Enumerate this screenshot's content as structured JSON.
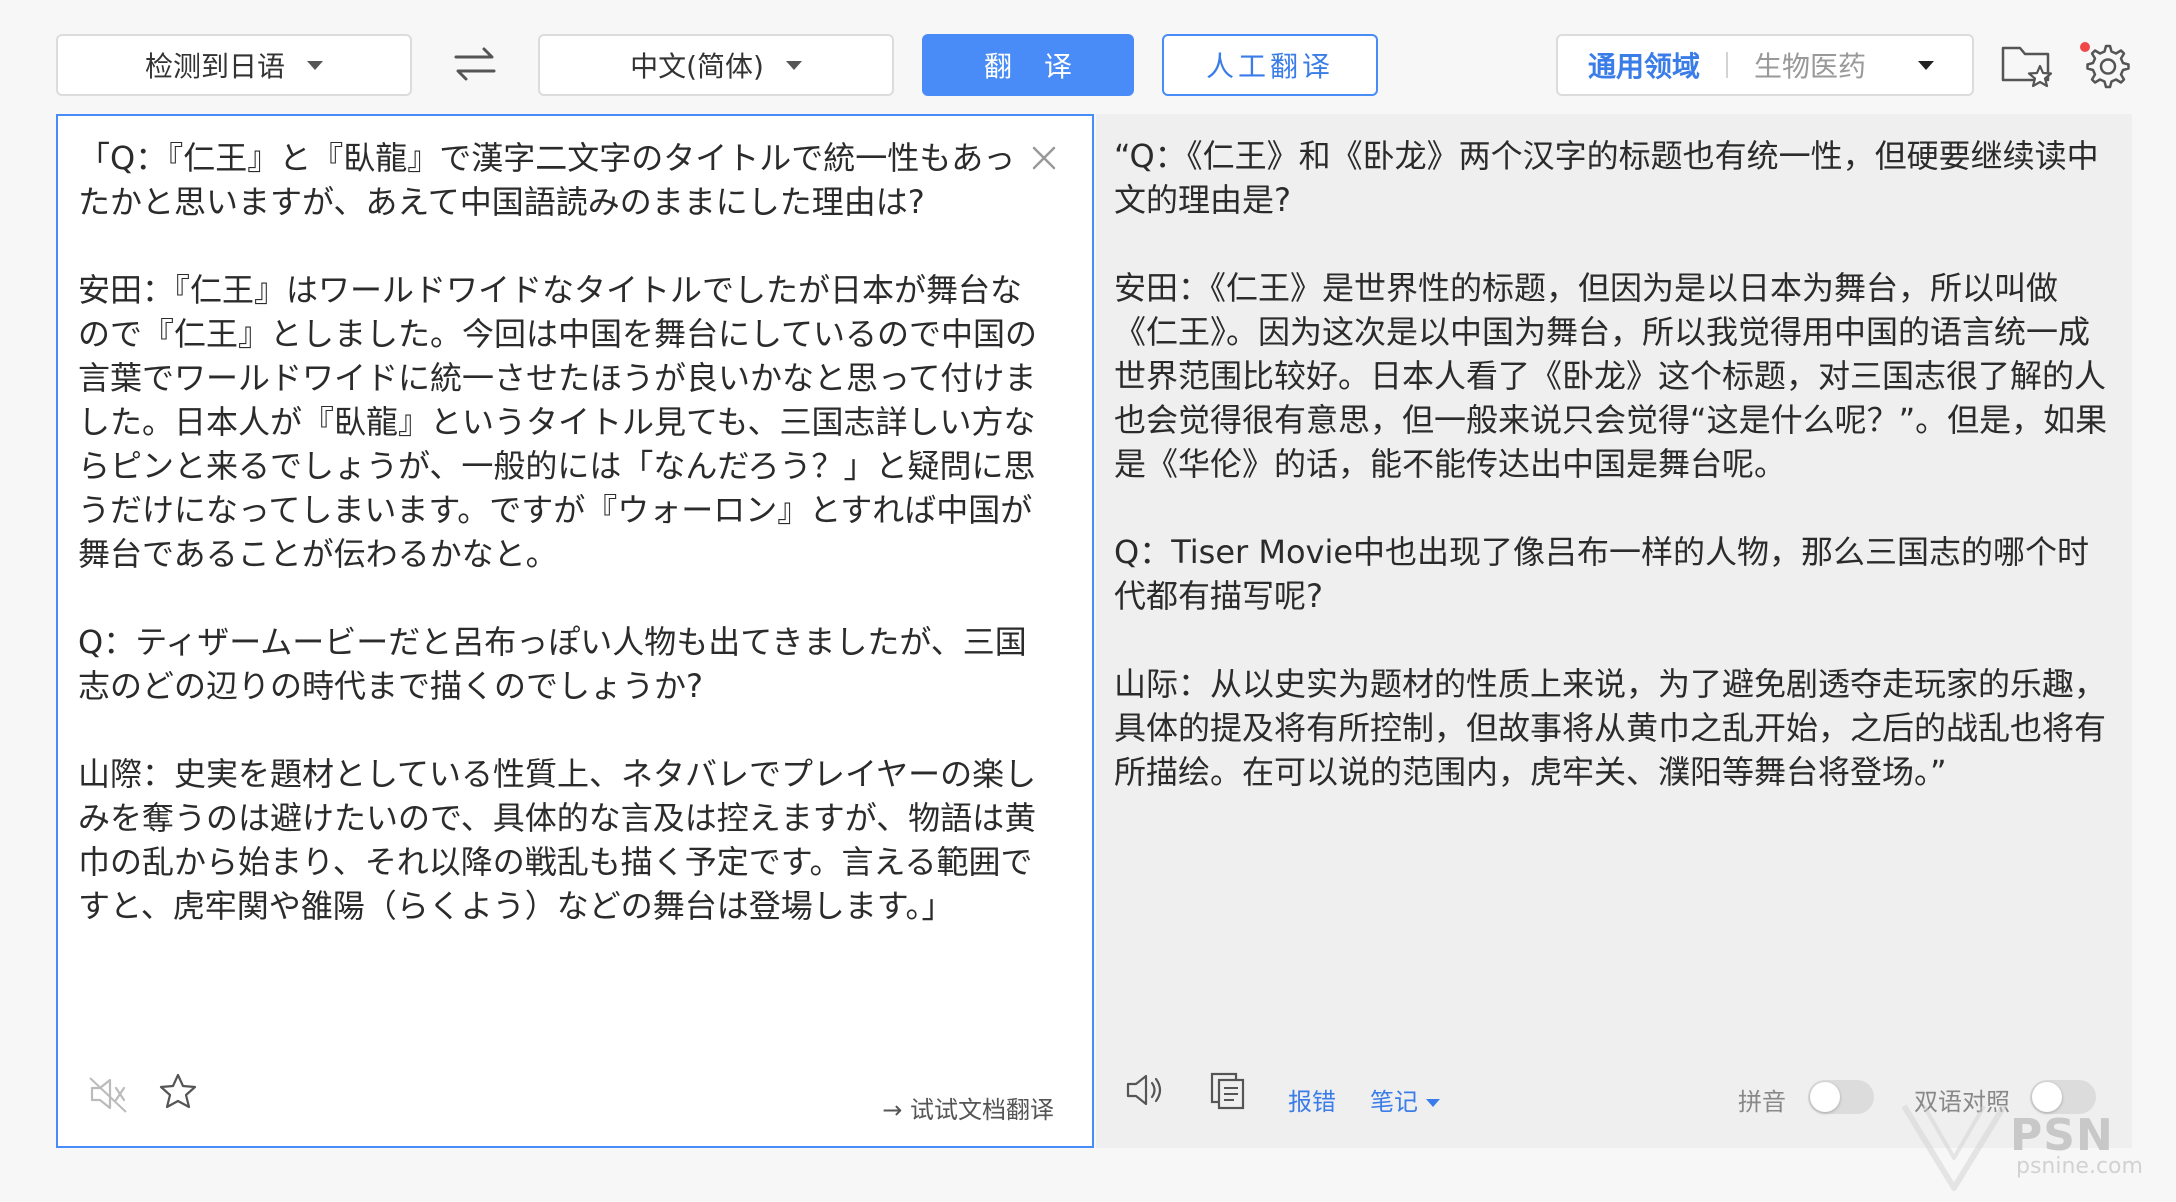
{
  "toolbar": {
    "source_lang": "检测到日语",
    "target_lang": "中文(简体)",
    "translate_label": "翻译",
    "human_translate_label": "人工翻译",
    "domain_general": "通用领域",
    "domain_bio": "生物医药"
  },
  "source": {
    "text": "「Q：『仁王』と『臥龍』で漢字二文字のタイトルで統一性もあったかと思いますが、あえて中国語読みのままにした理由は?\n\n安田：『仁王』はワールドワイドなタイトルでしたが日本が舞台なので『仁王』としました。今回は中国を舞台にしているので中国の言葉でワールドワイドに統一させたほうが良いかなと思って付けました。日本人が『臥龍』というタイトル見ても、三国志詳しい方ならピンと来るでしょうが、一般的には「なんだろう？」と疑問に思うだけになってしまいます。ですが『ウォーロン』とすれば中国が舞台であることが伝わるかなと。\n\nQ：ティザームービーだと呂布っぽい人物も出てきましたが、三国志のどの辺りの時代まで描くのでしょうか?\n\n山際：史実を題材としている性質上、ネタバレでプレイヤーの楽しみを奪うのは避けたいので、具体的な言及は控えますが、物語は黄巾の乱から始まり、それ以降の戦乱も描く予定です。言える範囲ですと、虎牢関や雒陽（らくよう）などの舞台は登場します。」",
    "doc_link": "→ 试试文档翻译"
  },
  "target": {
    "text": "“Q：《仁王》和《卧龙》两个汉字的标题也有统一性，但硬要继续读中文的理由是?\n\n安田：《仁王》是世界性的标题，但因为是以日本为舞台，所以叫做《仁王》。因为这次是以中国为舞台，所以我觉得用中国的语言统一成世界范围比较好。日本人看了《卧龙》这个标题，对三国志很了解的人也会觉得很有意思，但一般来说只会觉得“这是什么呢？”。但是，如果是《华伦》的话，能不能传达出中国是舞台呢。\n\nQ：Tiser Movie中也出现了像吕布一样的人物，那么三国志的哪个时代都有描写呢?\n\n山际：从以史实为题材的性质上来说，为了避免剧透夺走玩家的乐趣，具体的提及将有所控制，但故事将从黄巾之乱开始，之后的战乱也将有所描绘。在可以说的范围内，虎牢关、濮阳等舞台将登场。”",
    "report_label": "报错",
    "note_label": "笔记",
    "pinyin_label": "拼音",
    "bilingual_label": "双语对照"
  },
  "watermark": {
    "text": "PSN",
    "sub": "psnine.com"
  },
  "colors": {
    "accent": "#4a8cf7",
    "link": "#3b7de8"
  }
}
